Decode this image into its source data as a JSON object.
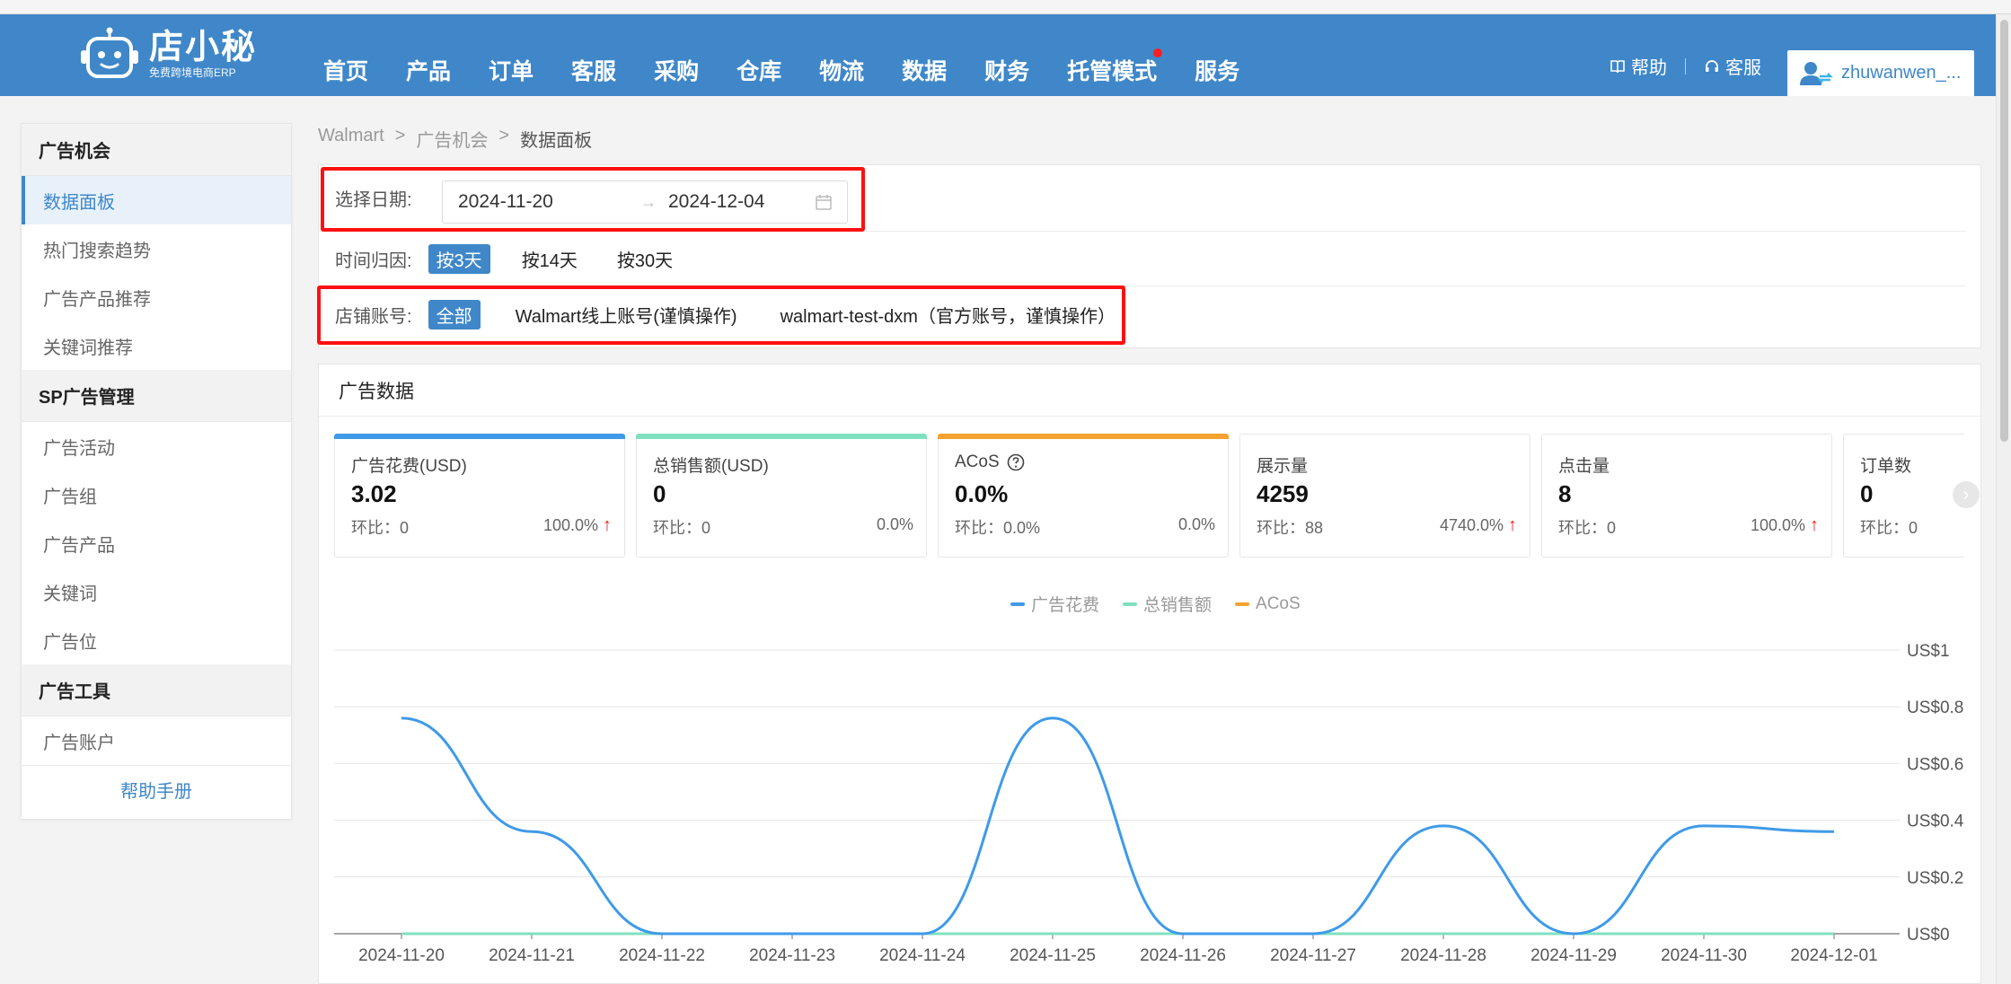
{
  "app": {
    "logo_text": "店小秘",
    "logo_sub": "免费跨境电商ERP",
    "brand_color": "#3f87c9"
  },
  "nav": [
    "首页",
    "产品",
    "订单",
    "客服",
    "采购",
    "仓库",
    "物流",
    "数据",
    "财务",
    "托管模式",
    "服务"
  ],
  "header": {
    "help": "帮助",
    "service": "客服",
    "username": "zhuwanwen_..."
  },
  "sidebar": {
    "groups": [
      {
        "title": "广告机会",
        "items": [
          "数据面板",
          "热门搜索趋势",
          "广告产品推荐",
          "关键词推荐"
        ]
      },
      {
        "title": "SP广告管理",
        "items": [
          "广告活动",
          "广告组",
          "广告产品",
          "关键词",
          "广告位"
        ]
      },
      {
        "title": "广告工具",
        "items": [
          "广告账户"
        ]
      }
    ],
    "active_item": "数据面板",
    "help_link": "帮助手册"
  },
  "breadcrumb": [
    "Walmart",
    "广告机会",
    "数据面板"
  ],
  "filters": {
    "date_label": "选择日期:",
    "start_date": "2024-11-20",
    "end_date": "2024-12-04",
    "date_arrow": "→",
    "attribution_label": "时间归因:",
    "attribution_options": [
      "按3天",
      "按14天",
      "按30天"
    ],
    "attribution_selected": "按3天",
    "store_label": "店铺账号:",
    "store_options": [
      "全部",
      "Walmart线上账号(谨慎操作)",
      "walmart-test-dxm（官方账号，谨慎操作）"
    ],
    "store_selected": "全部"
  },
  "ad_data": {
    "title": "广告数据",
    "cards": [
      {
        "title": "广告花费(USD)",
        "value": "3.02",
        "ratio": "环比：0",
        "pct": "100.0%",
        "up": true,
        "bar_color": "#3f9ae8"
      },
      {
        "title": "总销售额(USD)",
        "value": "0",
        "ratio": "环比：0",
        "pct": "0.0%",
        "up": false,
        "bar_color": "#7fe0c0"
      },
      {
        "title": "ACoS",
        "value": "0.0%",
        "ratio": "环比：0.0%",
        "pct": "0.0%",
        "up": false,
        "bar_color": "#f5a230",
        "has_help": true
      },
      {
        "title": "展示量",
        "value": "4259",
        "ratio": "环比：88",
        "pct": "4740.0%",
        "up": true,
        "bar_color": ""
      },
      {
        "title": "点击量",
        "value": "8",
        "ratio": "环比：0",
        "pct": "100.0%",
        "up": true,
        "bar_color": ""
      },
      {
        "title": "订单数",
        "value": "0",
        "ratio": "环比：0",
        "pct": "",
        "up": false,
        "bar_color": ""
      }
    ],
    "up_arrow": "↑",
    "next_glyph": "›"
  },
  "chart_data": {
    "type": "line",
    "categories": [
      "2024-11-20",
      "2024-11-21",
      "2024-11-22",
      "2024-11-23",
      "2024-11-24",
      "2024-11-25",
      "2024-11-26",
      "2024-11-27",
      "2024-11-28",
      "2024-11-29",
      "2024-11-30",
      "2024-12-01"
    ],
    "series": [
      {
        "name": "广告花费",
        "color": "#3f9ae8",
        "values": [
          0.76,
          0.36,
          0,
          0,
          0,
          0.76,
          0,
          0,
          0.38,
          0,
          0.38,
          0.36
        ]
      },
      {
        "name": "总销售额",
        "color": "#7fe0c0",
        "values": [
          0,
          0,
          0,
          0,
          0,
          0,
          0,
          0,
          0,
          0,
          0,
          0
        ]
      },
      {
        "name": "ACoS",
        "color": "#f5a230",
        "values": []
      }
    ],
    "y_ticks": [
      "US$0",
      "US$0.2",
      "US$0.4",
      "US$0.6",
      "US$0.8",
      "US$1"
    ],
    "ylim": [
      0,
      1
    ],
    "y_axis_position": "right",
    "legend_position": "top-center",
    "grid": true
  }
}
